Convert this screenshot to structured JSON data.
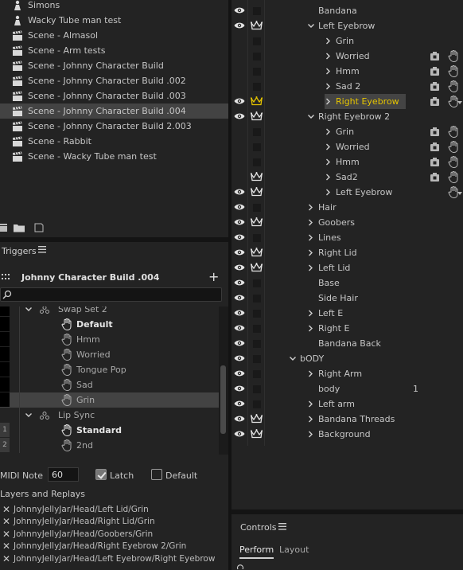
{
  "project": {
    "items": [
      {
        "label": "Simons",
        "icon": "puppet-icon"
      },
      {
        "label": "Wacky Tube man test",
        "icon": "puppet-icon"
      },
      {
        "label": "Scene - Almasol",
        "icon": "clapperboard-icon"
      },
      {
        "label": "Scene - Arm tests",
        "icon": "clapperboard-icon"
      },
      {
        "label": "Scene - Johnny Character Build",
        "icon": "clapperboard-icon"
      },
      {
        "label": "Scene - Johnny Character Build .002",
        "icon": "clapperboard-icon"
      },
      {
        "label": "Scene - Johnny Character Build .003",
        "icon": "clapperboard-icon"
      },
      {
        "label": "Scene - Johnny Character Build .004",
        "icon": "clapperboard-icon",
        "selected": true
      },
      {
        "label": "Scene - Johnny Character Build 2.003",
        "icon": "clapperboard-icon"
      },
      {
        "label": "Scene - Rabbit",
        "icon": "clapperboard-icon"
      },
      {
        "label": "Scene - Wacky Tube man test",
        "icon": "clapperboard-icon"
      }
    ]
  },
  "triggers": {
    "panel_title": "Triggers",
    "puppet_title": "Johnny Character Build .004",
    "search_placeholder": "",
    "rows": [
      {
        "label": "Swap Set 2",
        "type": "swapset",
        "key": "black"
      },
      {
        "label": "Default",
        "type": "trigger",
        "bold": true,
        "key": "black"
      },
      {
        "label": "Hmm",
        "type": "trigger",
        "key": "black"
      },
      {
        "label": "Worried",
        "type": "trigger",
        "key": "black"
      },
      {
        "label": "Tongue Pop",
        "type": "trigger",
        "key": "black"
      },
      {
        "label": "Sad",
        "type": "trigger",
        "key": "black"
      },
      {
        "label": "Grin",
        "type": "trigger",
        "key": "black",
        "selected": true
      },
      {
        "label": "Lip Sync",
        "type": "swapset",
        "key": "none"
      },
      {
        "label": "Standard",
        "type": "trigger",
        "bold": true,
        "key": "1"
      },
      {
        "label": "2nd",
        "type": "trigger",
        "key": "2"
      }
    ],
    "midi_label": "MIDI Note",
    "midi_value": "60",
    "latch_label": "Latch",
    "latch_checked": true,
    "default_label": "Default",
    "default_checked": false,
    "layers_title": "Layers and Replays",
    "replays": [
      "JohnnyJellyJar/Head/Left Lid/Grin",
      "JohnnyJellyJar/Head/Right Lid/Grin",
      "JohnnyJellyJar/Head/Goobers/Grin",
      "JohnnyJellyJar/Head/Right Eyebrow 2/Grin",
      "JohnnyJellyJar/Head/Left Eyebrow/Right Eyebrow"
    ]
  },
  "layers": {
    "rows": [
      {
        "label": "Bandana",
        "indent": 3,
        "chev": "",
        "eye": true,
        "crown": false
      },
      {
        "label": "Left Eyebrow",
        "indent": 3,
        "chev": "down",
        "eye": true,
        "crown": true
      },
      {
        "label": "Grin",
        "indent": 4,
        "chev": "right",
        "eye": false,
        "crown": false
      },
      {
        "label": "Worried",
        "indent": 4,
        "chev": "right",
        "eye": false,
        "crown": false,
        "icons": true
      },
      {
        "label": "Hmm",
        "indent": 4,
        "chev": "right",
        "eye": false,
        "crown": false,
        "icons": true
      },
      {
        "label": "Sad 2",
        "indent": 4,
        "chev": "right",
        "eye": false,
        "crown": false,
        "icons": true
      },
      {
        "label": "Right Eyebrow",
        "indent": 4,
        "chev": "right",
        "eye": true,
        "crown": true,
        "icons": true,
        "selected": true,
        "hand_menu": true
      },
      {
        "label": "Right Eyebrow 2",
        "indent": 3,
        "chev": "down",
        "eye": true,
        "crown": true
      },
      {
        "label": "Grin",
        "indent": 4,
        "chev": "right",
        "eye": false,
        "crown": false,
        "icons": true
      },
      {
        "label": "Worried",
        "indent": 4,
        "chev": "right",
        "eye": false,
        "crown": false,
        "icons": true
      },
      {
        "label": "Hmm",
        "indent": 4,
        "chev": "right",
        "eye": false,
        "crown": false,
        "icons": true
      },
      {
        "label": "Sad2",
        "indent": 4,
        "chev": "right",
        "eye": false,
        "crown": true,
        "icons": true
      },
      {
        "label": "Left Eyebrow",
        "indent": 4,
        "chev": "right",
        "eye": true,
        "crown": true,
        "hand_only": true,
        "hand_menu": true
      },
      {
        "label": "Hair",
        "indent": 3,
        "chev": "right",
        "eye": true,
        "crown": false
      },
      {
        "label": "Goobers",
        "indent": 3,
        "chev": "right",
        "eye": true,
        "crown": true
      },
      {
        "label": "Lines",
        "indent": 3,
        "chev": "right",
        "eye": true,
        "crown": false
      },
      {
        "label": "Right Lid",
        "indent": 3,
        "chev": "right",
        "eye": true,
        "crown": true
      },
      {
        "label": "Left Lid",
        "indent": 3,
        "chev": "right",
        "eye": true,
        "crown": true
      },
      {
        "label": "Base",
        "indent": 3,
        "chev": "",
        "eye": true,
        "crown": false
      },
      {
        "label": "Side Hair",
        "indent": 3,
        "chev": "",
        "eye": true,
        "crown": false
      },
      {
        "label": "Left E",
        "indent": 3,
        "chev": "right",
        "eye": true,
        "crown": false
      },
      {
        "label": "Right E",
        "indent": 3,
        "chev": "right",
        "eye": true,
        "crown": false
      },
      {
        "label": "Bandana Back",
        "indent": 3,
        "chev": "",
        "eye": true,
        "crown": false
      },
      {
        "label": "bODY",
        "indent": 2,
        "chev": "down",
        "eye": true,
        "crown": false
      },
      {
        "label": "Right Arm",
        "indent": 3,
        "chev": "right",
        "eye": true,
        "crown": false
      },
      {
        "label": "body",
        "indent": 3,
        "chev": "",
        "eye": true,
        "crown": false,
        "value": "1"
      },
      {
        "label": "Left arm",
        "indent": 3,
        "chev": "right",
        "eye": true,
        "crown": false
      },
      {
        "label": "Bandana Threads",
        "indent": 3,
        "chev": "right",
        "eye": true,
        "crown": true
      },
      {
        "label": "Background",
        "indent": 3,
        "chev": "right",
        "eye": true,
        "crown": true
      }
    ]
  },
  "controls": {
    "title": "Controls",
    "tabs": [
      "Perform",
      "Layout"
    ],
    "active_tab": "Perform"
  },
  "colors": {
    "accent_gold": "#e5c400",
    "panel_bg": "#232323",
    "selected_row": "#434343"
  }
}
